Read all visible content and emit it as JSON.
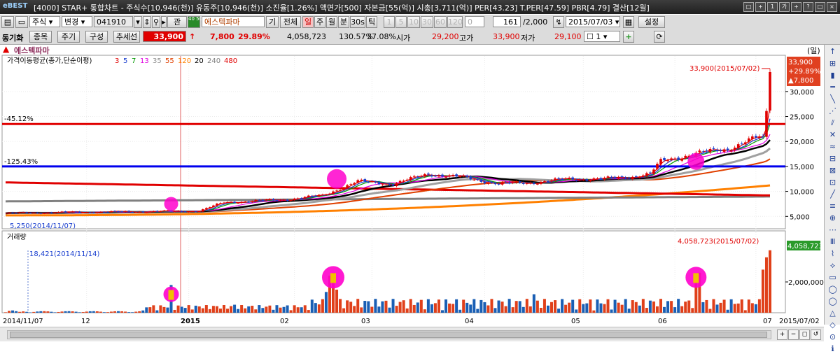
{
  "titlebar": {
    "logo": "eBEST",
    "text": "[4000] STAR+ 통합차트 - 주식수[10,946(천)] 유동주[10,946(천)] 소진율[1.26%] 액면가[500] 자본금[55(억)] 시총[3,711(억)] PER[43.23] T.PER[47.59] PBR[4.79] 결산[12월]",
    "buttons": [
      "□",
      "+",
      "1",
      "가",
      "+",
      "?",
      "□",
      "×"
    ]
  },
  "toolbar1": {
    "type_select": "주식",
    "change_label": "변경",
    "code": "041910",
    "gwan": "관",
    "code_badge": "40 50",
    "stock_name": "에스텍파마",
    "gi": "기",
    "all": "전체",
    "periods": [
      "일",
      "주",
      "월",
      "분",
      "30s",
      "틱"
    ],
    "minutes": [
      "1",
      "5",
      "10",
      "30",
      "60",
      "120"
    ],
    "zero_value": "0",
    "count": "161",
    "total": "/2,000",
    "date": "2015/07/03",
    "settings": "설정"
  },
  "toolbar2": {
    "sync": "동기화",
    "item": "종목",
    "cycle": "주기",
    "compose": "구성",
    "trendline": "추세선",
    "price": "33,900",
    "change": "7,800",
    "change_pct": "29.89%",
    "volume": "4,058,723",
    "vol_ratio": "130.57%",
    "turnover": "37.08%",
    "open_label": "시가",
    "open": "29,200",
    "high_label": "고가",
    "high": "33,900",
    "low_label": "저가",
    "low": "29,100",
    "ratio_value": "1"
  },
  "chart": {
    "stock_title": "에스텍파마",
    "unit": "(일)",
    "ma_label": "가격이동평균(종가,단순이평)",
    "ma_periods": [
      "3",
      "5",
      "7",
      "13",
      "35",
      "55",
      "120",
      "20",
      "240",
      "480"
    ],
    "ma_colors": [
      "#e00000",
      "#1a3fcf",
      "#009900",
      "#e000e0",
      "#909090",
      "#e04000",
      "#ff8000",
      "#000000",
      "#808080",
      "#e00000"
    ],
    "line1_label": "-45.12%",
    "line2_label": "-125.43%",
    "high_annotation": "33,900(2015/07/02)",
    "low_annotation": "5,250(2014/11/07)",
    "price_badge": [
      "33,900",
      "+29.89%",
      "▲7,800"
    ],
    "price_axis": [
      "30,000",
      "25,000",
      "20,000",
      "15,000",
      "10,000",
      "5,000"
    ],
    "volume_label": "거래량",
    "volume_high_annotation": "4,058,723(2015/07/02)",
    "volume_low_annotation": "18,421(2014/11/14)",
    "volume_badge": "4,058,723",
    "volume_axis": [
      "2,000,000"
    ],
    "x_labels": [
      "2014/11/07",
      "12",
      "2015",
      "02",
      "03",
      "04",
      "05",
      "06",
      "07"
    ],
    "last_date": "2015/07/02"
  },
  "chart_data": {
    "type": "candlestick",
    "price_axis": {
      "min": 3500,
      "max": 36000
    },
    "volume_axis": {
      "min": 0,
      "max": 4500000
    },
    "horizontal_lines": [
      {
        "label": "-45.12%",
        "value": 23500,
        "color": "#e00000"
      },
      {
        "label": "-125.43%",
        "value": 15000,
        "color": "#0000ee"
      }
    ],
    "high": {
      "date": "2015/07/02",
      "value": 33900
    },
    "low": {
      "date": "2014/11/07",
      "value": 5250
    },
    "close_anchors": [
      [
        0,
        5600
      ],
      [
        15,
        5800
      ],
      [
        30,
        5900
      ],
      [
        45,
        6000
      ],
      [
        55,
        6100
      ],
      [
        62,
        7800
      ],
      [
        68,
        8000
      ],
      [
        80,
        8400
      ],
      [
        90,
        9200
      ],
      [
        100,
        12000
      ],
      [
        110,
        11500
      ],
      [
        120,
        13500
      ],
      [
        130,
        12800
      ],
      [
        140,
        11500
      ],
      [
        150,
        11800
      ],
      [
        160,
        12500
      ],
      [
        170,
        12500
      ],
      [
        178,
        13000
      ],
      [
        183,
        13500
      ],
      [
        186,
        16000
      ],
      [
        195,
        17500
      ],
      [
        205,
        18500
      ],
      [
        210,
        20000
      ],
      [
        215,
        21000
      ],
      [
        216,
        26100
      ],
      [
        217,
        33900
      ]
    ],
    "volume_spikes": [
      [
        47,
        1800000
      ],
      [
        65,
        520000
      ],
      [
        91,
        1350000
      ],
      [
        92,
        2400000
      ],
      [
        93,
        2600000
      ],
      [
        94,
        1500000
      ],
      [
        150,
        1200000
      ],
      [
        196,
        2300000
      ],
      [
        197,
        2600000
      ],
      [
        215,
        2800000
      ],
      [
        216,
        3600000
      ],
      [
        217,
        4058723
      ]
    ]
  }
}
